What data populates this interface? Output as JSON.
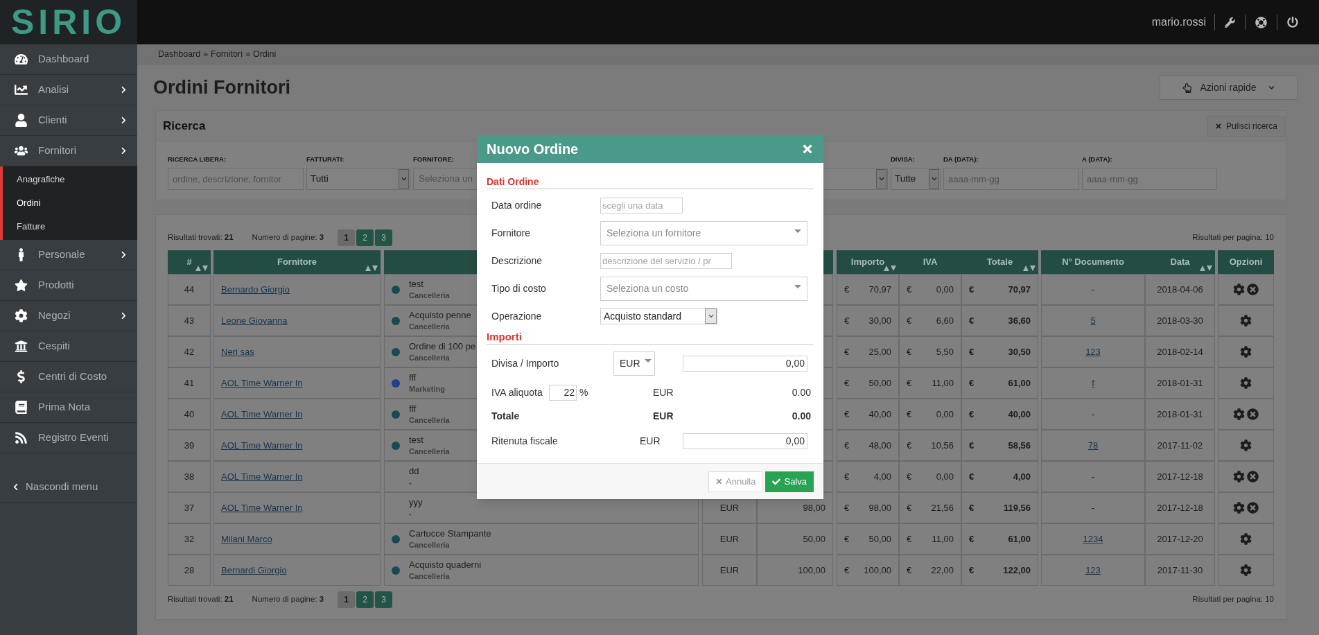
{
  "header": {
    "logo": "SIRIO",
    "user": "mario.rossi"
  },
  "sidebar": {
    "items": [
      {
        "label": "Dashboard",
        "kind": "dashboard",
        "has_submenu": false
      },
      {
        "label": "Analisi",
        "kind": "chart",
        "has_submenu": true
      },
      {
        "label": "Clienti",
        "kind": "user",
        "has_submenu": true
      },
      {
        "label": "Fornitori",
        "kind": "users",
        "has_submenu": true,
        "expanded": true,
        "children": [
          {
            "label": "Anagrafiche",
            "selected": false
          },
          {
            "label": "Ordini",
            "selected": true
          },
          {
            "label": "Fatture",
            "selected": false
          }
        ]
      },
      {
        "label": "Personale",
        "kind": "male",
        "has_submenu": true
      },
      {
        "label": "Prodotti",
        "kind": "star",
        "has_submenu": false
      },
      {
        "label": "Negozi",
        "kind": "cog",
        "has_submenu": true
      },
      {
        "label": "Cespiti",
        "kind": "bank",
        "has_submenu": false
      },
      {
        "label": "Centri di Costo",
        "kind": "dollar",
        "has_submenu": false
      },
      {
        "label": "Prima Nota",
        "kind": "book",
        "has_submenu": false
      },
      {
        "label": "Registro Eventi",
        "kind": "rss",
        "has_submenu": false
      }
    ],
    "hide_menu": "Nascondi menu"
  },
  "breadcrumb": {
    "separator": "»",
    "items": [
      "Dashboard",
      "Fornitori",
      "Ordini"
    ]
  },
  "page_title": "Ordini Fornitori",
  "quick_actions": "Azioni rapide",
  "search": {
    "title": "Ricerca",
    "clear_button": "Pulisci ricerca",
    "filters": [
      {
        "label": "RICERCA LIBERA:",
        "kind": "input",
        "placeholder": "ordine, descrizione, fornitor"
      },
      {
        "label": "FATTURATI:",
        "kind": "select",
        "value": "Tutti"
      },
      {
        "label": "FORNITORE:",
        "kind": "select2",
        "placeholder": "Seleziona un"
      },
      {
        "kind": "select"
      },
      {
        "label": "DIVISA:",
        "kind": "select",
        "value": "Tutte"
      },
      {
        "label": "DA (DATA):",
        "kind": "input",
        "placeholder": "aaaa-mm-gg"
      },
      {
        "label": "A (DATA):",
        "kind": "input",
        "placeholder": "aaaa-mm-gg"
      }
    ]
  },
  "results_top": {
    "found": "Risultati trovati: **21**",
    "pages": "Numero di pagine: **3**",
    "per_page": "Risultati per pagina: 10",
    "pagination": [
      {
        "label": "1",
        "selected": true
      },
      {
        "label": "2",
        "selected": false
      },
      {
        "label": "3",
        "selected": false
      }
    ]
  },
  "table": {
    "columns_left": [
      {
        "label": "#",
        "sortable": true
      },
      {
        "label": "Fornitore",
        "sortable": true
      }
    ],
    "columns_right": [
      {
        "label": "Importo",
        "sortable": true
      },
      {
        "label": "IVA",
        "sortable": false
      },
      {
        "label": "Totale",
        "sortable": true
      },
      {
        "label": "N° Documento",
        "sortable": false
      },
      {
        "label": "Data",
        "sortable": true
      },
      {
        "label": "Opzioni",
        "sortable": false
      }
    ],
    "rows": [
      {
        "id": "44",
        "supplier": "Bernardo Giorgio",
        "description": "test",
        "category": "Cancelleria",
        "color": "#174a52",
        "amounts": [
          {
            "symbol": "€",
            "value": "70,97"
          },
          {
            "symbol": "€",
            "value": "0,00"
          },
          {
            "symbol": "€",
            "value": "70,97"
          }
        ],
        "document": {
          "text": "-",
          "linked": false
        },
        "date": "2018-04-06",
        "actions": [
          {
            "kind": "edit"
          },
          {
            "kind": "delete"
          }
        ]
      },
      {
        "id": "43",
        "supplier": "Leone Giovanna",
        "description": "Acquisto penne",
        "category": "Cancelleria",
        "color": "#174a52",
        "amounts": [
          {
            "symbol": "€",
            "value": "30,00"
          },
          {
            "symbol": "€",
            "value": "6,60"
          },
          {
            "symbol": "€",
            "value": "36,60"
          }
        ],
        "document": {
          "text": "5",
          "linked": true
        },
        "date": "2018-03-30",
        "actions": [
          {
            "kind": "edit"
          }
        ]
      },
      {
        "id": "42",
        "supplier": "Neri sas",
        "description": "Ordine di 100 pe",
        "category": "Cancelleria",
        "color": "#174a52",
        "amounts": [
          {
            "symbol": "€",
            "value": "25,00"
          },
          {
            "symbol": "€",
            "value": "5,50"
          },
          {
            "symbol": "€",
            "value": "30,50"
          }
        ],
        "document": {
          "text": "123",
          "linked": true
        },
        "date": "2018-02-14",
        "actions": [
          {
            "kind": "edit"
          }
        ]
      },
      {
        "id": "41",
        "supplier": "AOL Time Warner In",
        "description": "fff",
        "category": "Marketing",
        "color": "#1f3f8f",
        "amounts": [
          {
            "symbol": "€",
            "value": "50,00"
          },
          {
            "symbol": "€",
            "value": "11,00"
          },
          {
            "symbol": "€",
            "value": "61,00"
          }
        ],
        "document": {
          "text": "f",
          "linked": true
        },
        "date": "2018-01-31",
        "actions": [
          {
            "kind": "edit"
          }
        ]
      },
      {
        "id": "40",
        "supplier": "AOL Time Warner In",
        "description": "fff",
        "category": "Cancelleria",
        "color": "#174a52",
        "amounts": [
          {
            "symbol": "€",
            "value": "40,00"
          },
          {
            "symbol": "€",
            "value": "0,00"
          },
          {
            "symbol": "€",
            "value": "40,00"
          }
        ],
        "document": {
          "text": "-",
          "linked": false
        },
        "date": "2018-01-31",
        "actions": [
          {
            "kind": "edit"
          },
          {
            "kind": "delete"
          }
        ]
      },
      {
        "id": "39",
        "supplier": "AOL Time Warner In",
        "description": "test",
        "category": "Cancelleria",
        "color": "#174a52",
        "amounts": [
          {
            "symbol": "€",
            "value": "48,00"
          },
          {
            "symbol": "€",
            "value": "10,56"
          },
          {
            "symbol": "€",
            "value": "58,56"
          }
        ],
        "document": {
          "text": "78",
          "linked": true
        },
        "date": "2017-11-02",
        "actions": [
          {
            "kind": "edit"
          }
        ]
      },
      {
        "id": "38",
        "supplier": "AOL Time Warner In",
        "description": "dd",
        "category": "-",
        "amounts": [
          {
            "symbol": "€",
            "value": "4,00"
          },
          {
            "symbol": "€",
            "value": "0,00"
          },
          {
            "symbol": "€",
            "value": "4,00"
          }
        ],
        "document": {
          "text": "-",
          "linked": false
        },
        "date": "2017-12-18",
        "actions": [
          {
            "kind": "edit"
          },
          {
            "kind": "delete"
          }
        ]
      },
      {
        "id": "37",
        "supplier": "AOL Time Warner In",
        "description": "yyy",
        "category": "-",
        "currency": "EUR",
        "original_amount": "98,00",
        "amounts": [
          {
            "symbol": "€",
            "value": "98,00"
          },
          {
            "symbol": "€",
            "value": "21,56"
          },
          {
            "symbol": "€",
            "value": "119,56"
          }
        ],
        "document": {
          "text": "-",
          "linked": false
        },
        "date": "2017-12-18",
        "actions": [
          {
            "kind": "edit"
          },
          {
            "kind": "delete"
          }
        ]
      },
      {
        "id": "32",
        "supplier": "Milani Marco",
        "description": "Cartucce Stampante",
        "category": "Cancelleria",
        "color": "#174a52",
        "currency": "EUR",
        "original_amount": "50,00",
        "amounts": [
          {
            "symbol": "€",
            "value": "50,00"
          },
          {
            "symbol": "€",
            "value": "11,00"
          },
          {
            "symbol": "€",
            "value": "61,00"
          }
        ],
        "document": {
          "text": "1234",
          "linked": true
        },
        "date": "2017-12-20",
        "actions": [
          {
            "kind": "edit"
          }
        ]
      },
      {
        "id": "28",
        "supplier": "Bernardi Giorgio",
        "description": "Acquisto quaderni",
        "category": "Cancelleria",
        "color": "#174a52",
        "currency": "EUR",
        "original_amount": "100,00",
        "amounts": [
          {
            "symbol": "€",
            "value": "100,00"
          },
          {
            "symbol": "€",
            "value": "22,00"
          },
          {
            "symbol": "€",
            "value": "122,00"
          }
        ],
        "document": {
          "text": "123",
          "linked": true
        },
        "date": "2017-11-30",
        "actions": [
          {
            "kind": "edit"
          }
        ]
      }
    ]
  },
  "results_bottom": {
    "found": "Risultati trovati: **21**",
    "pages": "Numero di pagine: **3**",
    "per_page": "Risultati per pagina: 10",
    "pagination": [
      {
        "label": "1",
        "selected": true
      },
      {
        "label": "2",
        "selected": false
      },
      {
        "label": "3",
        "selected": false
      }
    ]
  },
  "modal": {
    "title": "Nuovo Ordine",
    "order_section": {
      "title": "Dati Ordine",
      "fields": [
        {
          "label": "Data ordine",
          "kind": "date",
          "placeholder": "scegli una data"
        },
        {
          "label": "Fornitore",
          "kind": "select2",
          "placeholder": "Seleziona un fornitore"
        },
        {
          "label": "Descrizione",
          "kind": "text",
          "placeholder": "descrizione del servizio / pr"
        },
        {
          "label": "Tipo di costo",
          "kind": "select2",
          "placeholder": "Seleziona un costo"
        },
        {
          "label": "Operazione",
          "kind": "select",
          "value": "Acquisto standard"
        }
      ]
    },
    "amounts_section": {
      "title": "Importi",
      "currency_row": {
        "label": "Divisa / Importo",
        "currency": "EUR",
        "amount": "0,00"
      },
      "vat_row": {
        "label": "IVA aliquota",
        "rate": "22",
        "unit": "%",
        "currency": "EUR",
        "value": "0.00"
      },
      "total_row": {
        "label": "Totale",
        "currency": "EUR",
        "value": "0.00"
      },
      "withholding_row": {
        "label": "Ritenuta fiscale",
        "currency": "EUR",
        "amount": "0,00"
      }
    },
    "cancel_button": "Annulla",
    "save_button": "Salva"
  }
}
